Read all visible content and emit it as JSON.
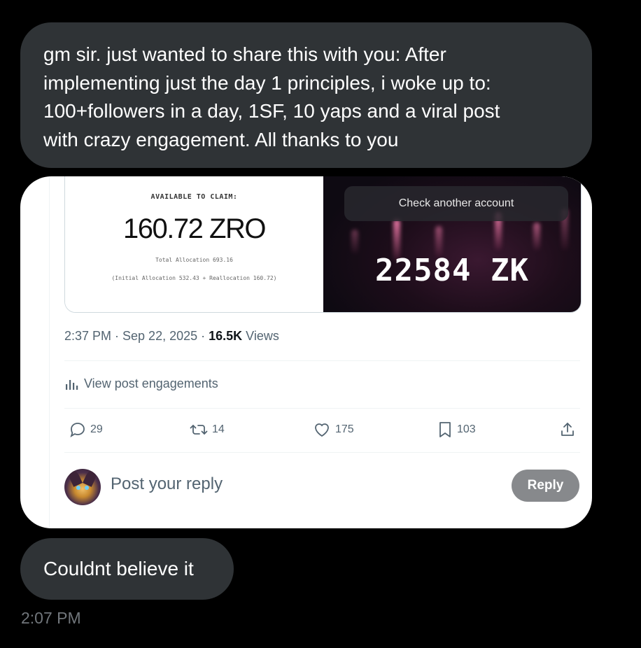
{
  "messages": [
    {
      "lines": [
        "gm sir. just wanted to share this with you: After",
        "implementing just the day 1 principles, i woke up to:",
        "100+followers in a day, 1SF, 10 yaps and a viral post",
        "with crazy engagement. All thanks to you"
      ]
    },
    {
      "text": "Couldnt believe it"
    }
  ],
  "shared_post": {
    "left_image": {
      "label": "AVAILABLE TO CLAIM:",
      "amount": "160.72 ZRO",
      "total": "Total Allocation 693.16",
      "breakdown": "(Initial Allocation 532.43 + Reallocation 160.72)"
    },
    "right_image": {
      "button": "Check another account",
      "amount": "22584 ZK"
    },
    "meta": {
      "time_date": "2:37 PM · Sep 22, 2025 · ",
      "views_count": "16.5K",
      "views_label": " Views"
    },
    "engagements_link": "View post engagements",
    "actions": {
      "replies": "29",
      "reposts": "14",
      "likes": "175",
      "bookmarks": "103"
    },
    "reply_placeholder": "Post your reply",
    "reply_button": "Reply"
  },
  "timestamp": "2:07 PM",
  "colors": {
    "bubble": "#2f3336",
    "muted_text": "#536471",
    "reply_button": "#87898c"
  },
  "icons": [
    "chart-icon",
    "reply-icon",
    "repost-icon",
    "like-icon",
    "bookmark-icon",
    "share-icon"
  ]
}
